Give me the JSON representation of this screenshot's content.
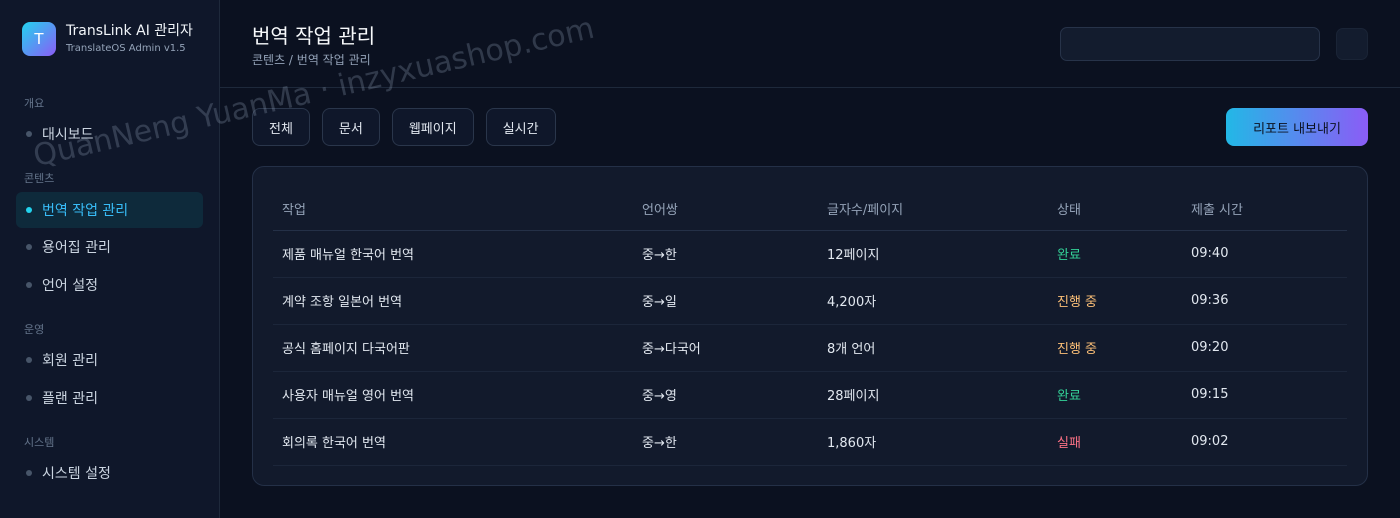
{
  "brand": {
    "logo_letter": "T",
    "title": "TransLink AI 관리자",
    "subtitle": "TranslateOS Admin v1.5"
  },
  "sidebar": {
    "sections": [
      {
        "title": "개요",
        "items": [
          {
            "label": "대시보드",
            "active": false
          }
        ]
      },
      {
        "title": "콘텐츠",
        "items": [
          {
            "label": "번역 작업 관리",
            "active": true
          },
          {
            "label": "용어집 관리",
            "active": false
          },
          {
            "label": "언어 설정",
            "active": false
          }
        ]
      },
      {
        "title": "운영",
        "items": [
          {
            "label": "회원 관리",
            "active": false
          },
          {
            "label": "플랜 관리",
            "active": false
          }
        ]
      },
      {
        "title": "시스템",
        "items": [
          {
            "label": "시스템 설정",
            "active": false
          }
        ]
      }
    ]
  },
  "header": {
    "title": "번역 작업 관리",
    "breadcrumb": "콘텐츠 / 번역 작업 관리",
    "search_value": ""
  },
  "filters": [
    "전체",
    "문서",
    "웹페이지",
    "실시간"
  ],
  "export_label": "리포트 내보내기",
  "table": {
    "columns": [
      "작업",
      "언어쌍",
      "글자수/페이지",
      "상태",
      "제출 시간"
    ],
    "rows": [
      {
        "task": "제품 매뉴얼 한국어 번역",
        "pair": "중→한",
        "size": "12페이지",
        "status": "완료",
        "status_kind": "done",
        "time": "09:40"
      },
      {
        "task": "계약 조항 일본어 번역",
        "pair": "중→일",
        "size": "4,200자",
        "status": "진행 중",
        "status_kind": "progress",
        "time": "09:36"
      },
      {
        "task": "공식 홈페이지 다국어판",
        "pair": "중→다국어",
        "size": "8개 언어",
        "status": "진행 중",
        "status_kind": "progress",
        "time": "09:20"
      },
      {
        "task": "사용자 매뉴얼 영어 번역",
        "pair": "중→영",
        "size": "28페이지",
        "status": "완료",
        "status_kind": "done",
        "time": "09:15"
      },
      {
        "task": "회의록 한국어 번역",
        "pair": "중→한",
        "size": "1,860자",
        "status": "실패",
        "status_kind": "fail",
        "time": "09:02"
      }
    ]
  },
  "watermark": "QuanNeng YuanMa · inzyxuashop.com",
  "colors": {
    "accent": "#22d3ee",
    "accent2": "#8b5cf6",
    "done": "#34d399",
    "progress": "#fbbf77",
    "fail": "#fb7185"
  }
}
